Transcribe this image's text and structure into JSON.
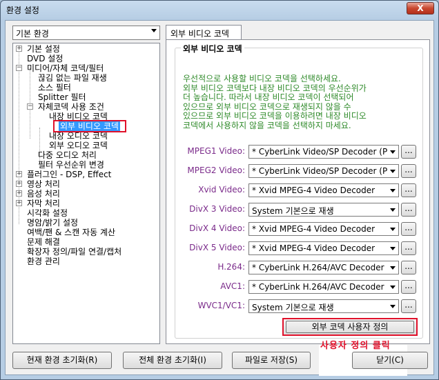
{
  "window": {
    "title": "환경 설정",
    "close_label": "X"
  },
  "preset": {
    "selected": "기본 환경"
  },
  "tree": [
    {
      "label": "기본 설정",
      "toggle": "+"
    },
    {
      "label": "DVD 설정",
      "toggle": ""
    },
    {
      "label": "미디어/자체 코덱/필터",
      "toggle": "−"
    },
    {
      "label": "끊김 없는 파일 재생",
      "toggle": ""
    },
    {
      "label": "소스 필터",
      "toggle": ""
    },
    {
      "label": "Splitter 필터",
      "toggle": ""
    },
    {
      "label": "자체코덱 사용 조건",
      "toggle": "−"
    },
    {
      "label": "내장 비디오 코덱",
      "toggle": ""
    },
    {
      "label": "외부 비디오 코덱",
      "toggle": ""
    },
    {
      "label": "내장 오디오 코덱",
      "toggle": ""
    },
    {
      "label": "외부 오디오 코덱",
      "toggle": ""
    },
    {
      "label": "다중 오디오 처리",
      "toggle": ""
    },
    {
      "label": "필터 우선순위 변경",
      "toggle": ""
    },
    {
      "label": "플러그인 - DSP, Effect",
      "toggle": "+"
    },
    {
      "label": "영상 처리",
      "toggle": "+"
    },
    {
      "label": "음성 처리",
      "toggle": "+"
    },
    {
      "label": "자막 처리",
      "toggle": "+"
    },
    {
      "label": "시각화 설정",
      "toggle": ""
    },
    {
      "label": "명암/밝기 설정",
      "toggle": ""
    },
    {
      "label": "여백/팬 & 스캔 자동 계산",
      "toggle": ""
    },
    {
      "label": "문제 해결",
      "toggle": ""
    },
    {
      "label": "확장자 정의/파일 연결/캡처",
      "toggle": ""
    },
    {
      "label": "환경 관리",
      "toggle": ""
    }
  ],
  "tab": {
    "label": "외부 비디오 코덱"
  },
  "panel": {
    "group_title": "외부 비디오 코덱",
    "description": "우선적으로 사용할 비디오 코덱을 선택하세요.\n외부 비디오 코덱보다 내장 비디오 코덱의 우선순위가\n더 높습니다. 따라서 내장 비디오 코덱이 선택되어\n있으므로 외부 비디오 코덱으로 재생되지 않을 수\n있으므로 외부 비디오 코덱을 이용하려면 내장 비디오\n코덱에서 사용하지 않을 코덱을 선택하지 마세요.",
    "codecs": [
      {
        "label": "MPEG1 Video:",
        "value": "* CyberLink Video/SP Decoder (P",
        "more": "..."
      },
      {
        "label": "MPEG2 Video:",
        "value": "* CyberLink Video/SP Decoder (P",
        "more": "..."
      },
      {
        "label": "Xvid Video:",
        "value": "* Xvid MPEG-4 Video Decoder",
        "more": "..."
      },
      {
        "label": "DivX 3 Video:",
        "value": "System 기본으로 재생",
        "more": "..."
      },
      {
        "label": "DivX 4 Video:",
        "value": "* Xvid MPEG-4 Video Decoder",
        "more": "..."
      },
      {
        "label": "DivX 5 Video:",
        "value": "* Xvid MPEG-4 Video Decoder",
        "more": "..."
      },
      {
        "label": "H.264:",
        "value": "* CyberLink H.264/AVC Decoder (",
        "more": "..."
      },
      {
        "label": "AVC1:",
        "value": "* CyberLink H.264/AVC Decoder (",
        "more": "..."
      },
      {
        "label": "WVC1/VC1:",
        "value": "System 기본으로 재생",
        "more": "..."
      }
    ],
    "custom_button": "외부 코덱 사용자 정의",
    "note": "사용자 정의 클릭"
  },
  "footer": {
    "reset_current": "현재 환경 초기화(R)",
    "reset_all": "전체 환경 초기화(I)",
    "save_file": "파일로 저장(S)",
    "close": "닫기(C)"
  }
}
